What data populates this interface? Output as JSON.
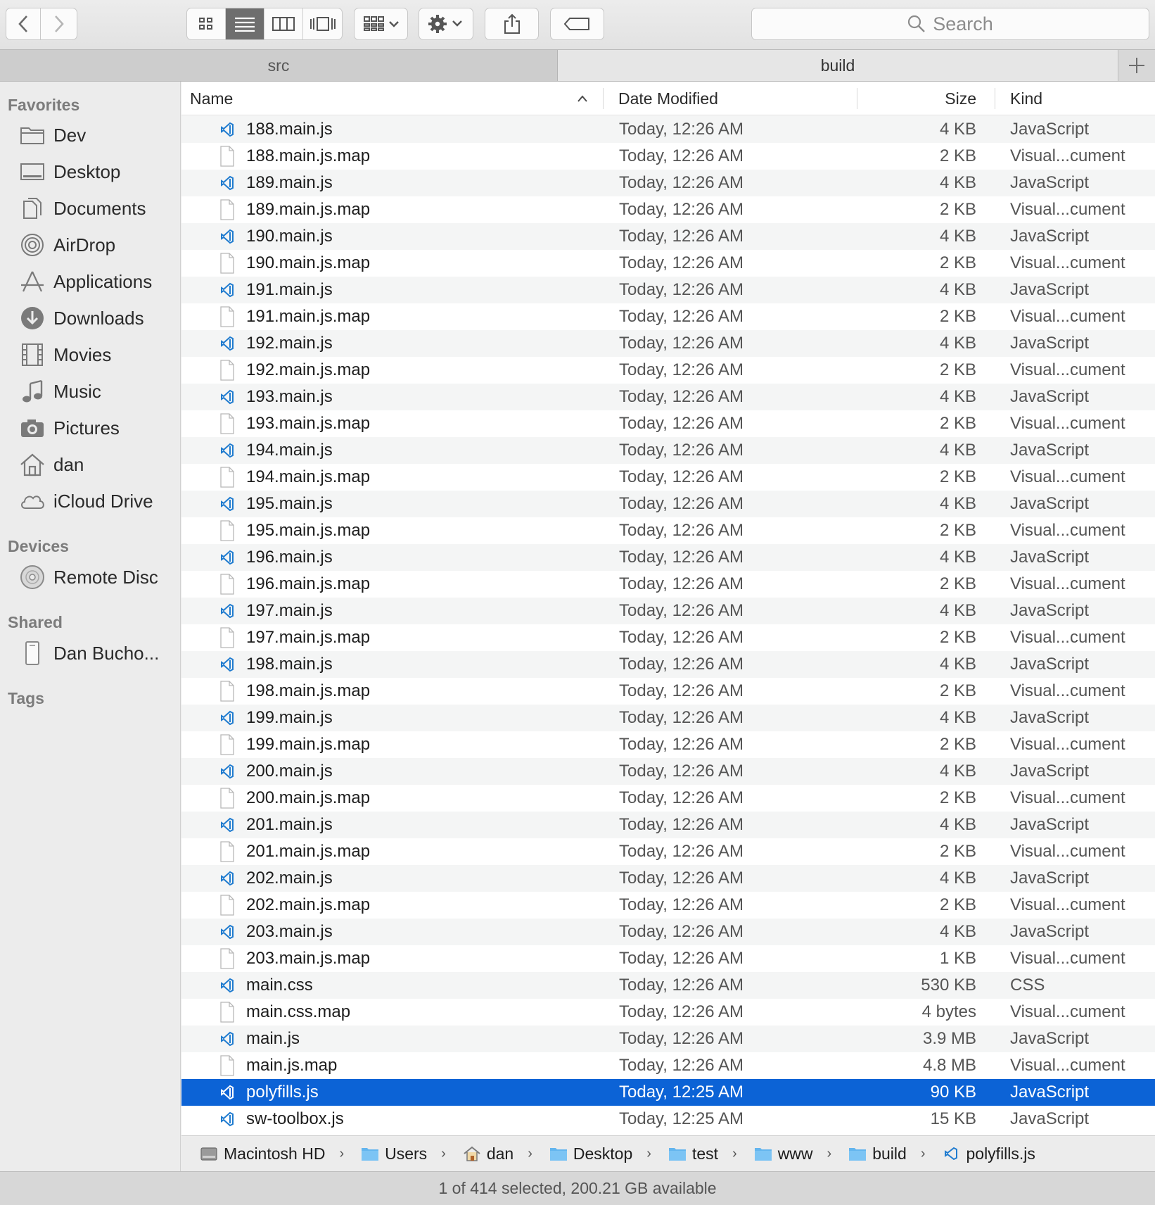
{
  "toolbar": {
    "search_placeholder": "Search",
    "nav": [
      "back-icon",
      "forward-icon"
    ],
    "view_modes": [
      "icon-view",
      "list-view",
      "column-view",
      "cover-flow-view"
    ],
    "active_view": "list-view"
  },
  "tabs": [
    {
      "label": "src",
      "active": false
    },
    {
      "label": "build",
      "active": true
    }
  ],
  "sidebar": {
    "favorites_heading": "Favorites",
    "favorites": [
      {
        "label": "Dev",
        "icon": "folder-icon"
      },
      {
        "label": "Desktop",
        "icon": "desktop-icon"
      },
      {
        "label": "Documents",
        "icon": "documents-icon"
      },
      {
        "label": "AirDrop",
        "icon": "airdrop-icon"
      },
      {
        "label": "Applications",
        "icon": "applications-icon"
      },
      {
        "label": "Downloads",
        "icon": "downloads-icon"
      },
      {
        "label": "Movies",
        "icon": "movies-icon"
      },
      {
        "label": "Music",
        "icon": "music-icon"
      },
      {
        "label": "Pictures",
        "icon": "pictures-icon"
      },
      {
        "label": "dan",
        "icon": "home-icon"
      },
      {
        "label": "iCloud Drive",
        "icon": "cloud-icon"
      }
    ],
    "devices_heading": "Devices",
    "devices": [
      {
        "label": "Remote Disc",
        "icon": "disc-icon"
      }
    ],
    "shared_heading": "Shared",
    "shared": [
      {
        "label": "Dan Bucho...",
        "icon": "computer-icon"
      }
    ],
    "tags_heading": "Tags"
  },
  "columns": {
    "name": "Name",
    "date": "Date Modified",
    "size": "Size",
    "kind": "Kind"
  },
  "files": [
    {
      "name": "188.main.js",
      "date": "Today, 12:26 AM",
      "size": "4 KB",
      "kind": "JavaScript",
      "type": "js"
    },
    {
      "name": "188.main.js.map",
      "date": "Today, 12:26 AM",
      "size": "2 KB",
      "kind": "Visual...cument",
      "type": "doc"
    },
    {
      "name": "189.main.js",
      "date": "Today, 12:26 AM",
      "size": "4 KB",
      "kind": "JavaScript",
      "type": "js"
    },
    {
      "name": "189.main.js.map",
      "date": "Today, 12:26 AM",
      "size": "2 KB",
      "kind": "Visual...cument",
      "type": "doc"
    },
    {
      "name": "190.main.js",
      "date": "Today, 12:26 AM",
      "size": "4 KB",
      "kind": "JavaScript",
      "type": "js"
    },
    {
      "name": "190.main.js.map",
      "date": "Today, 12:26 AM",
      "size": "2 KB",
      "kind": "Visual...cument",
      "type": "doc"
    },
    {
      "name": "191.main.js",
      "date": "Today, 12:26 AM",
      "size": "4 KB",
      "kind": "JavaScript",
      "type": "js"
    },
    {
      "name": "191.main.js.map",
      "date": "Today, 12:26 AM",
      "size": "2 KB",
      "kind": "Visual...cument",
      "type": "doc"
    },
    {
      "name": "192.main.js",
      "date": "Today, 12:26 AM",
      "size": "4 KB",
      "kind": "JavaScript",
      "type": "js"
    },
    {
      "name": "192.main.js.map",
      "date": "Today, 12:26 AM",
      "size": "2 KB",
      "kind": "Visual...cument",
      "type": "doc"
    },
    {
      "name": "193.main.js",
      "date": "Today, 12:26 AM",
      "size": "4 KB",
      "kind": "JavaScript",
      "type": "js"
    },
    {
      "name": "193.main.js.map",
      "date": "Today, 12:26 AM",
      "size": "2 KB",
      "kind": "Visual...cument",
      "type": "doc"
    },
    {
      "name": "194.main.js",
      "date": "Today, 12:26 AM",
      "size": "4 KB",
      "kind": "JavaScript",
      "type": "js"
    },
    {
      "name": "194.main.js.map",
      "date": "Today, 12:26 AM",
      "size": "2 KB",
      "kind": "Visual...cument",
      "type": "doc"
    },
    {
      "name": "195.main.js",
      "date": "Today, 12:26 AM",
      "size": "4 KB",
      "kind": "JavaScript",
      "type": "js"
    },
    {
      "name": "195.main.js.map",
      "date": "Today, 12:26 AM",
      "size": "2 KB",
      "kind": "Visual...cument",
      "type": "doc"
    },
    {
      "name": "196.main.js",
      "date": "Today, 12:26 AM",
      "size": "4 KB",
      "kind": "JavaScript",
      "type": "js"
    },
    {
      "name": "196.main.js.map",
      "date": "Today, 12:26 AM",
      "size": "2 KB",
      "kind": "Visual...cument",
      "type": "doc"
    },
    {
      "name": "197.main.js",
      "date": "Today, 12:26 AM",
      "size": "4 KB",
      "kind": "JavaScript",
      "type": "js"
    },
    {
      "name": "197.main.js.map",
      "date": "Today, 12:26 AM",
      "size": "2 KB",
      "kind": "Visual...cument",
      "type": "doc"
    },
    {
      "name": "198.main.js",
      "date": "Today, 12:26 AM",
      "size": "4 KB",
      "kind": "JavaScript",
      "type": "js"
    },
    {
      "name": "198.main.js.map",
      "date": "Today, 12:26 AM",
      "size": "2 KB",
      "kind": "Visual...cument",
      "type": "doc"
    },
    {
      "name": "199.main.js",
      "date": "Today, 12:26 AM",
      "size": "4 KB",
      "kind": "JavaScript",
      "type": "js"
    },
    {
      "name": "199.main.js.map",
      "date": "Today, 12:26 AM",
      "size": "2 KB",
      "kind": "Visual...cument",
      "type": "doc"
    },
    {
      "name": "200.main.js",
      "date": "Today, 12:26 AM",
      "size": "4 KB",
      "kind": "JavaScript",
      "type": "js"
    },
    {
      "name": "200.main.js.map",
      "date": "Today, 12:26 AM",
      "size": "2 KB",
      "kind": "Visual...cument",
      "type": "doc"
    },
    {
      "name": "201.main.js",
      "date": "Today, 12:26 AM",
      "size": "4 KB",
      "kind": "JavaScript",
      "type": "js"
    },
    {
      "name": "201.main.js.map",
      "date": "Today, 12:26 AM",
      "size": "2 KB",
      "kind": "Visual...cument",
      "type": "doc"
    },
    {
      "name": "202.main.js",
      "date": "Today, 12:26 AM",
      "size": "4 KB",
      "kind": "JavaScript",
      "type": "js"
    },
    {
      "name": "202.main.js.map",
      "date": "Today, 12:26 AM",
      "size": "2 KB",
      "kind": "Visual...cument",
      "type": "doc"
    },
    {
      "name": "203.main.js",
      "date": "Today, 12:26 AM",
      "size": "4 KB",
      "kind": "JavaScript",
      "type": "js"
    },
    {
      "name": "203.main.js.map",
      "date": "Today, 12:26 AM",
      "size": "1 KB",
      "kind": "Visual...cument",
      "type": "doc"
    },
    {
      "name": "main.css",
      "date": "Today, 12:26 AM",
      "size": "530 KB",
      "kind": "CSS",
      "type": "js"
    },
    {
      "name": "main.css.map",
      "date": "Today, 12:26 AM",
      "size": "4 bytes",
      "kind": "Visual...cument",
      "type": "doc"
    },
    {
      "name": "main.js",
      "date": "Today, 12:26 AM",
      "size": "3.9 MB",
      "kind": "JavaScript",
      "type": "js"
    },
    {
      "name": "main.js.map",
      "date": "Today, 12:26 AM",
      "size": "4.8 MB",
      "kind": "Visual...cument",
      "type": "doc"
    },
    {
      "name": "polyfills.js",
      "date": "Today, 12:25 AM",
      "size": "90 KB",
      "kind": "JavaScript",
      "type": "js",
      "selected": true
    },
    {
      "name": "sw-toolbox.js",
      "date": "Today, 12:25 AM",
      "size": "15 KB",
      "kind": "JavaScript",
      "type": "js"
    }
  ],
  "path": [
    {
      "label": "Macintosh HD",
      "icon": "hard-drive-icon"
    },
    {
      "label": "Users",
      "icon": "folder-icon"
    },
    {
      "label": "dan",
      "icon": "home-icon"
    },
    {
      "label": "Desktop",
      "icon": "folder-icon"
    },
    {
      "label": "test",
      "icon": "folder-icon"
    },
    {
      "label": "www",
      "icon": "folder-icon"
    },
    {
      "label": "build",
      "icon": "folder-icon"
    },
    {
      "label": "polyfills.js",
      "icon": "vscode-file-icon"
    }
  ],
  "status": "1 of 414 selected, 200.21 GB available",
  "colors": {
    "selection": "#0c63d6",
    "folder": "#63b5ee",
    "vscode": "#1f7bcf"
  }
}
